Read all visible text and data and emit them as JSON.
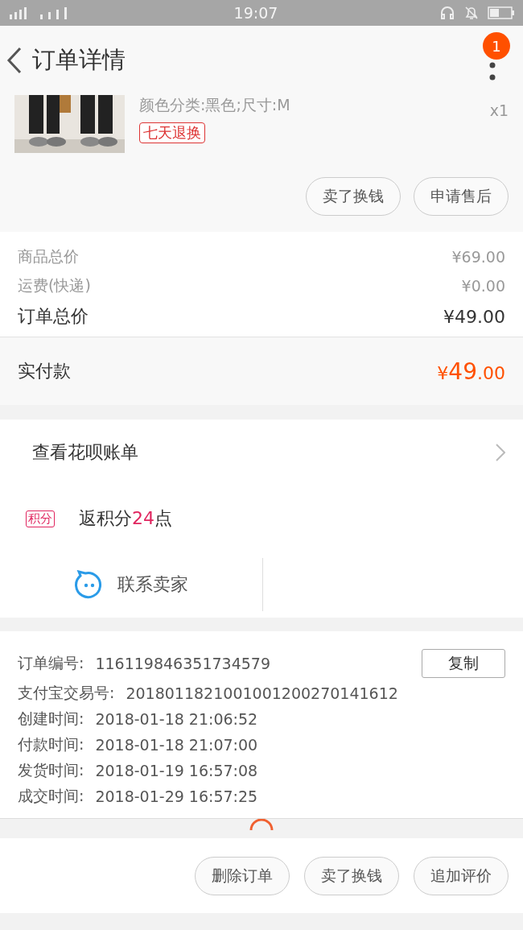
{
  "status_bar": {
    "time": "19:07"
  },
  "header": {
    "title": "订单详情",
    "badge": "1"
  },
  "product": {
    "kind": "picture",
    "spec": "颜色分类:黑色;尺寸:M",
    "tag": "七天退换",
    "quantity": "x1",
    "buttons": [
      "卖了换钱",
      "申请售后"
    ]
  },
  "prices": [
    {
      "label": "商品总价",
      "value": "¥69.00",
      "kind": "minor"
    },
    {
      "label": "运费(快递)",
      "value": "¥0.00",
      "kind": "minor"
    },
    {
      "label": "订单总价",
      "value": "¥49.00",
      "kind": "major"
    }
  ],
  "paid": {
    "label": "实付款",
    "currency": "¥",
    "integer": "49",
    "decimal": ".00"
  },
  "huabei": {
    "label": "查看花呗账单"
  },
  "points": {
    "tag": "积分",
    "prefix": "返积分",
    "number": "24",
    "suffix": "点"
  },
  "contact": {
    "label": "联系卖家"
  },
  "order_info": [
    {
      "label": "订单编号:",
      "value": "116119846351734579"
    },
    {
      "label": "支付宝交易号:",
      "value": "2018011821001001200270141612"
    },
    {
      "label": "创建时间:",
      "value": "2018-01-18 21:06:52"
    },
    {
      "label": "付款时间:",
      "value": "2018-01-18 21:07:00"
    },
    {
      "label": "发货时间:",
      "value": "2018-01-19 16:57:08"
    },
    {
      "label": "成交时间:",
      "value": "2018-01-29 16:57:25"
    }
  ],
  "copy_button": "复制",
  "bottom_buttons": [
    "删除订单",
    "卖了换钱",
    "追加评价"
  ]
}
